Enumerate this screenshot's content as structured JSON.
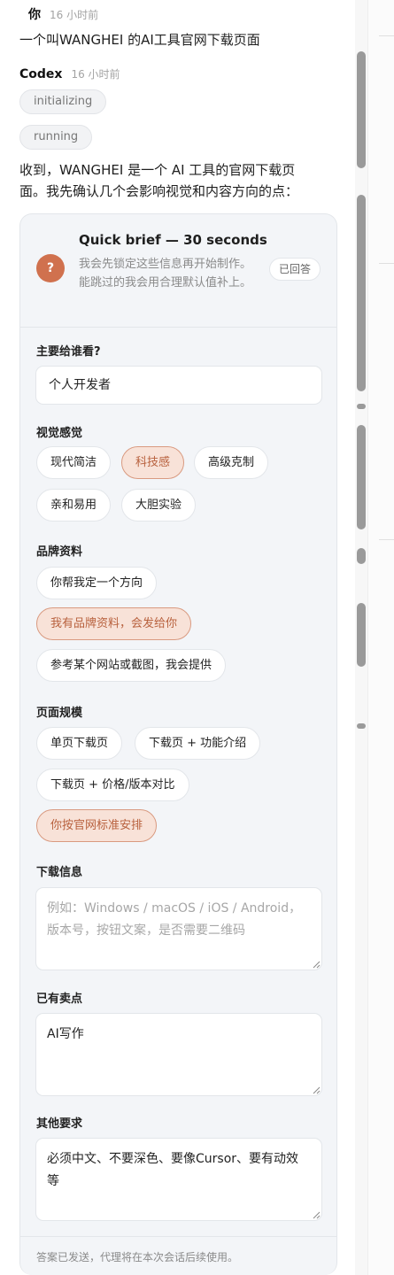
{
  "user": {
    "name": "你",
    "time": "16 小时前",
    "message": "一个叫WANGHEI 的AI工具官网下载页面"
  },
  "agent": {
    "name": "Codex",
    "time": "16 小时前",
    "status_pills": [
      "initializing",
      "running"
    ],
    "message": "收到，WANGHEI 是一个 AI 工具的官网下载页面。我先确认几个会影响视觉和内容方向的点："
  },
  "brief": {
    "badge_icon": "question-mark",
    "badge_symbol": "?",
    "title": "Quick brief — 30 seconds",
    "subtitle": "我会先锁定这些信息再开始制作。能跳过的我会用合理默认值补上。",
    "answered_label": "已回答",
    "accent_color": "#d0714e",
    "selected_bg": "#f8e2d8",
    "audience": {
      "label": "主要给谁看?",
      "value": "个人开发者"
    },
    "visual": {
      "label": "视觉感觉",
      "options": [
        "现代简洁",
        "科技感",
        "高级克制",
        "亲和易用",
        "大胆实验"
      ],
      "selected": "科技感"
    },
    "brand": {
      "label": "品牌资料",
      "options": [
        "你帮我定一个方向",
        "我有品牌资料，会发给你",
        "参考某个网站或截图，我会提供"
      ],
      "selected": "我有品牌资料，会发给你"
    },
    "scale": {
      "label": "页面规模",
      "options": [
        "单页下载页",
        "下载页 + 功能介绍",
        "下载页 + 价格/版本对比",
        "你按官网标准安排"
      ],
      "selected": "你按官网标准安排"
    },
    "download_info": {
      "label": "下载信息",
      "placeholder": "例如：Windows / macOS / iOS / Android，版本号，按钮文案，是否需要二维码",
      "value": ""
    },
    "selling_points": {
      "label": "已有卖点",
      "value": "AI写作"
    },
    "other": {
      "label": "其他要求",
      "value": "必须中文、不要深色、要像Cursor、要有动效等"
    },
    "footer": "答案已发送，代理将在本次会话后续使用。"
  }
}
